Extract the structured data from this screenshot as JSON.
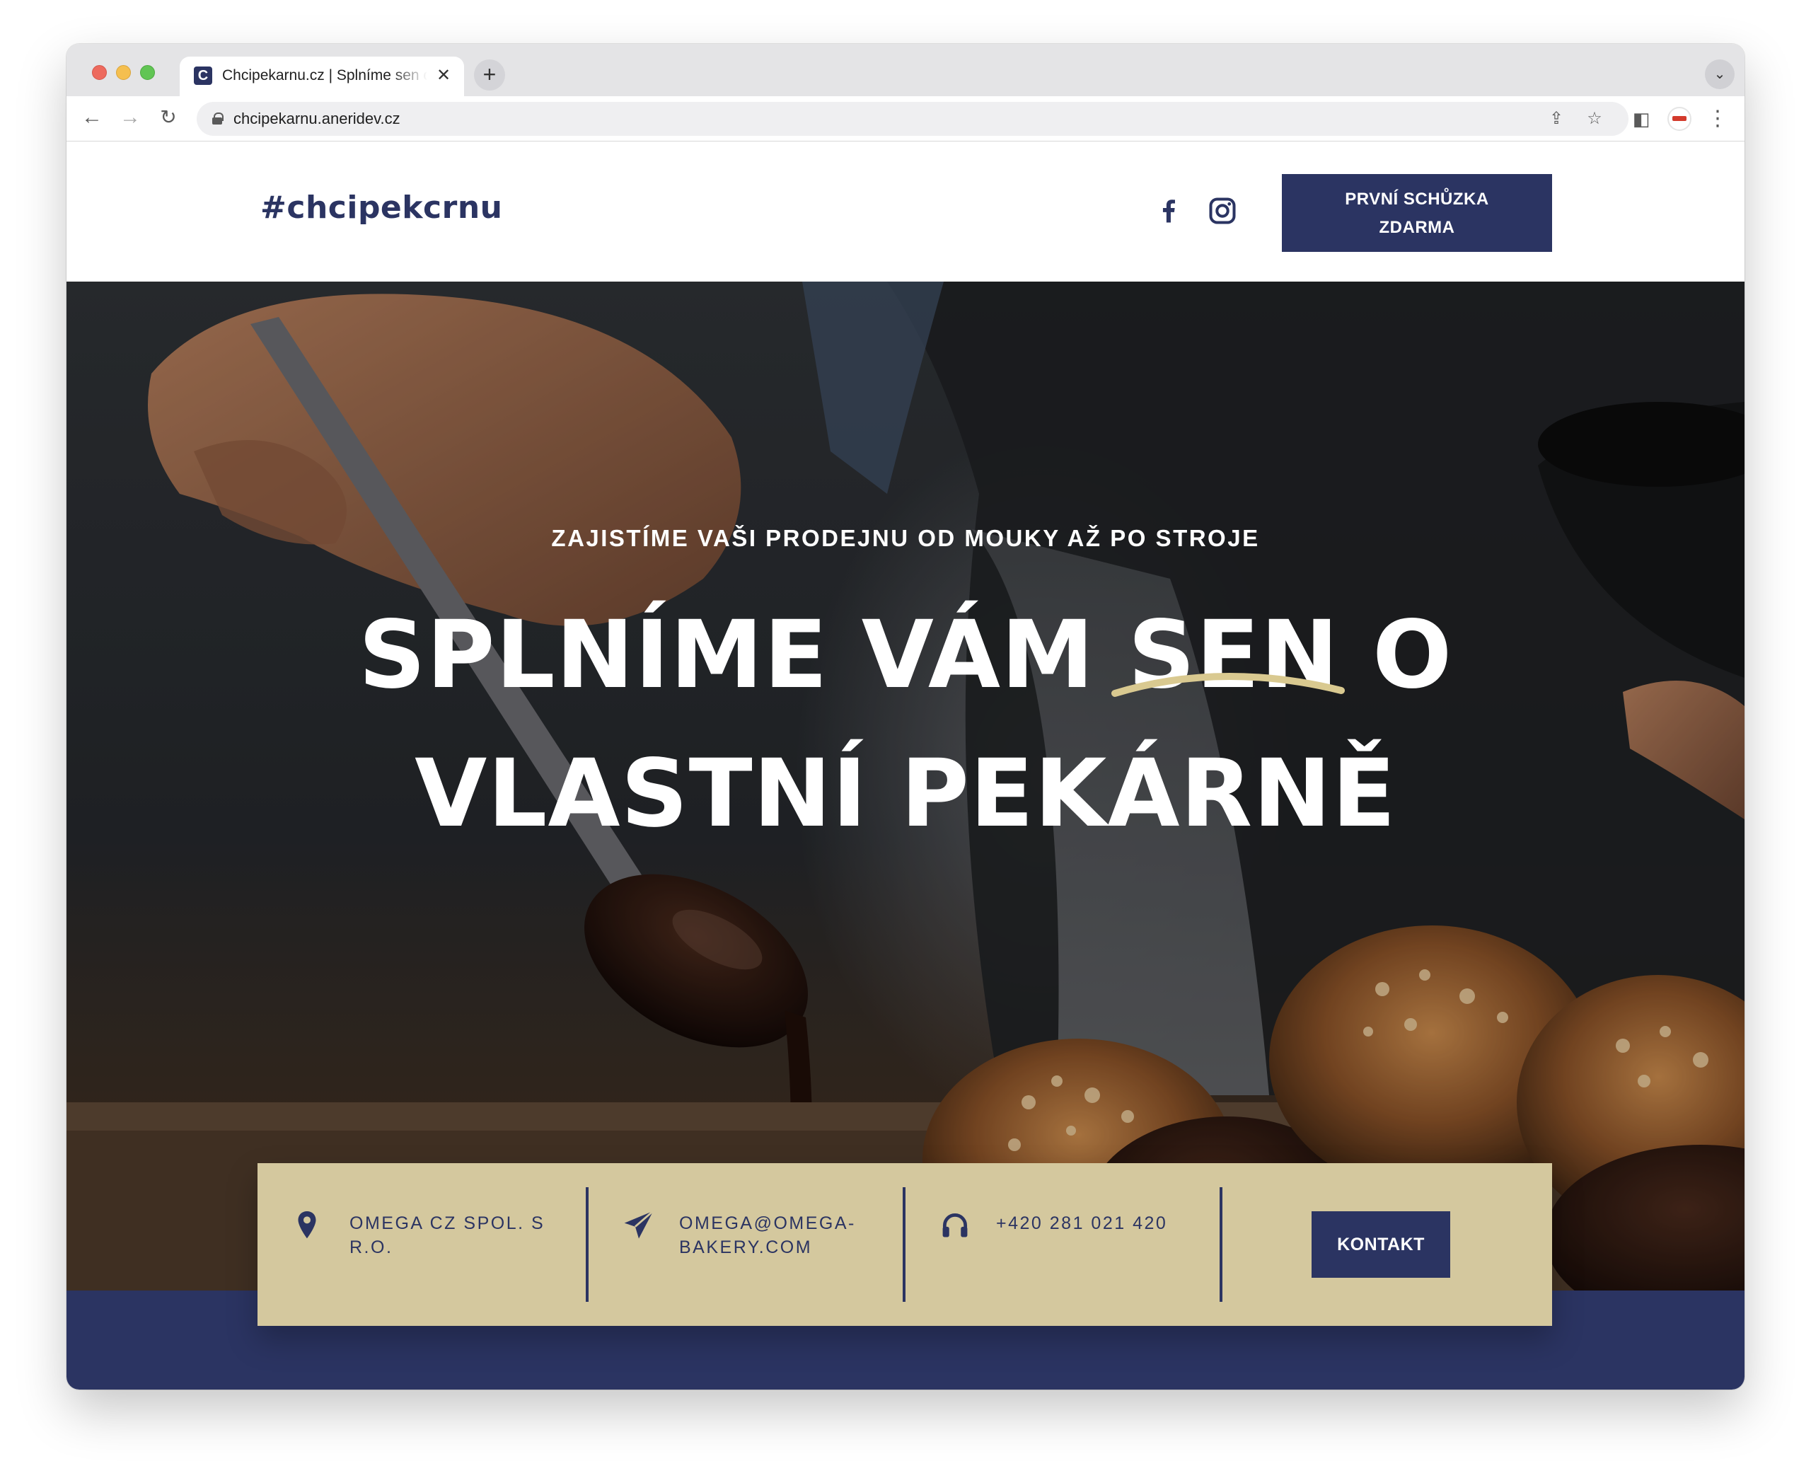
{
  "browser": {
    "tab_title": "Chcipekarnu.cz | Splníme sen o vlastní pekárně",
    "favicon_letter": "C",
    "close_glyph": "✕",
    "newtab_glyph": "+",
    "url": "chcipekarnu.aneridev.cz"
  },
  "header": {
    "logo": "#chcipekcrnu",
    "social": [
      "facebook-icon",
      "instagram-icon"
    ],
    "cta_line1": "PRVNÍ SCHŮZKA",
    "cta_line2": "ZDARMA"
  },
  "hero": {
    "subtitle": "ZAJISTÍME VAŠI PRODEJNU OD MOUKY AŽ PO STROJE",
    "title_part1": "SPLNÍME VÁM ",
    "title_highlight": "SEN",
    "title_part2": " O",
    "title_line2": "VLASTNÍ PEKÁRNĚ"
  },
  "info": {
    "company": "OMEGA CZ SPOL. S R.O.",
    "email": "OMEGA@OMEGA-BAKERY.COM",
    "phone": "+420 281 021 420",
    "contact_button": "KONTAKT"
  },
  "colors": {
    "navy": "#2b3462",
    "beige": "#d4c89e",
    "swoosh": "#d9c990"
  }
}
